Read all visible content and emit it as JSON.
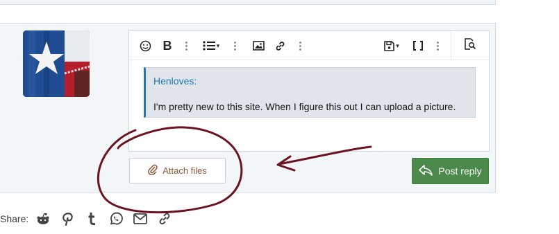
{
  "editor": {
    "toolbar": {
      "bold_label": "B",
      "caret": "▾"
    },
    "quote": {
      "author": "Henloves:",
      "text": "I'm pretty new to this site. When I figure this out I can upload a picture."
    }
  },
  "actions": {
    "attach_label": "Attach files",
    "post_label": "Post reply"
  },
  "share": {
    "label": "Share:",
    "icons": [
      "reddit-icon",
      "pinterest-icon",
      "tumblr-icon",
      "whatsapp-icon",
      "email-icon",
      "link-icon"
    ]
  },
  "colors": {
    "accent": "#2577b1",
    "post_button": "#4b8a4a",
    "attach_text": "#8a5a3a",
    "annotation": "#6b1420"
  }
}
